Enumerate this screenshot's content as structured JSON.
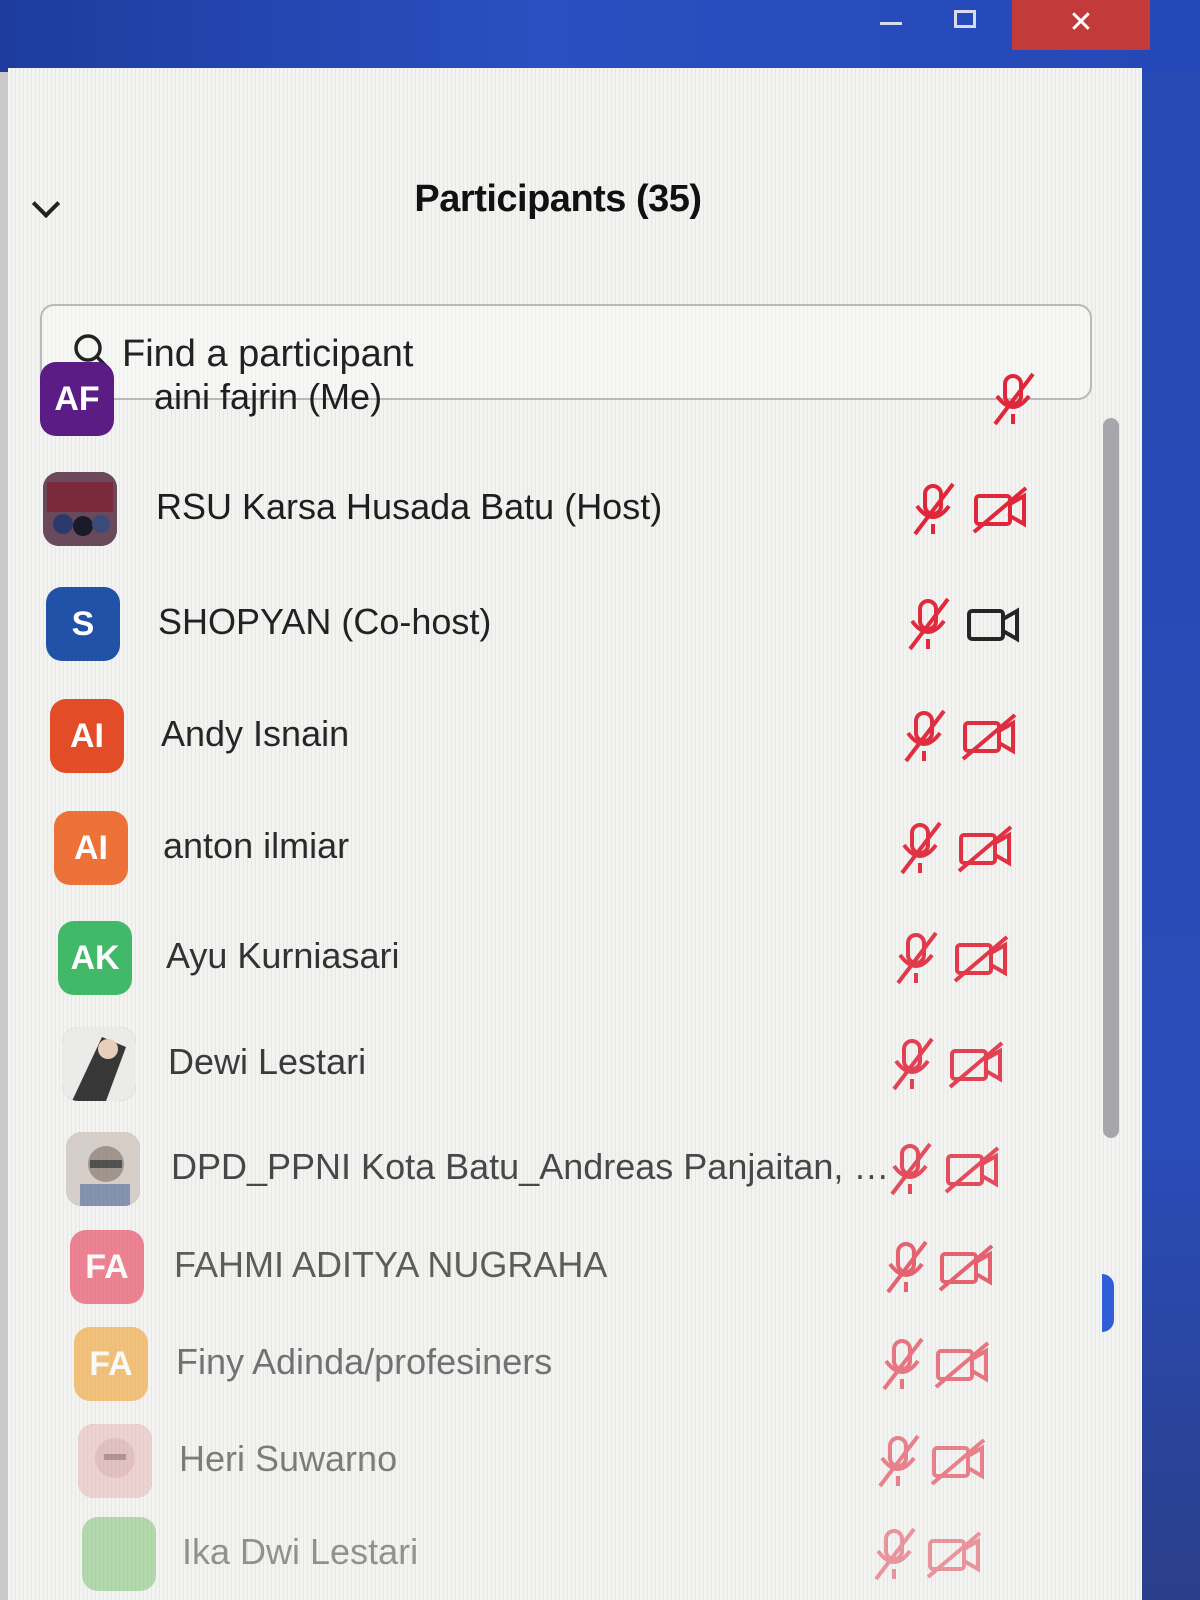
{
  "window": {
    "close_glyph": "✕"
  },
  "panel": {
    "title": "Participants (35)",
    "search": {
      "placeholder": "Find a participant"
    }
  },
  "colors": {
    "muted_red": "#e0263a",
    "video_on": "#222222"
  },
  "participants": [
    {
      "initials": "AF",
      "avatar_color": "#5b1c86",
      "name": "aini fajrin (Me)",
      "mic": "muted",
      "video": "none"
    },
    {
      "initials": "",
      "avatar_color": "photo",
      "name": "RSU Karsa Husada Batu (Host)",
      "mic": "muted",
      "video": "off"
    },
    {
      "initials": "S",
      "avatar_color": "#1e4fa6",
      "name": "SHOPYAN (Co-host)",
      "mic": "muted",
      "video": "on"
    },
    {
      "initials": "AI",
      "avatar_color": "#e2461f",
      "name": "Andy Isnain",
      "mic": "muted",
      "video": "off"
    },
    {
      "initials": "AI",
      "avatar_color": "#ec6a2e",
      "name": "anton ilmiar",
      "mic": "muted",
      "video": "off"
    },
    {
      "initials": "AK",
      "avatar_color": "#2fb35b",
      "name": "Ayu Kurniasari",
      "mic": "muted",
      "video": "off"
    },
    {
      "initials": "",
      "avatar_color": "photo",
      "name": "Dewi Lestari",
      "mic": "muted",
      "video": "off"
    },
    {
      "initials": "",
      "avatar_color": "photo",
      "name": "DPD_PPNI Kota Batu_Andreas Panjaitan, S. ...",
      "mic": "muted",
      "video": "off"
    },
    {
      "initials": "FA",
      "avatar_color": "#e8556a",
      "name": "FAHMI ADITYA NUGRAHA",
      "mic": "muted",
      "video": "off"
    },
    {
      "initials": "FA",
      "avatar_color": "#f0a030",
      "name": "Finy Adinda/profesiners",
      "mic": "muted",
      "video": "off"
    },
    {
      "initials": "",
      "avatar_color": "photo",
      "name": "Heri Suwarno",
      "mic": "muted",
      "video": "off"
    },
    {
      "initials": "",
      "avatar_color": "#67b85a",
      "name": "Ika Dwi Lestari",
      "mic": "muted",
      "video": "off"
    }
  ]
}
